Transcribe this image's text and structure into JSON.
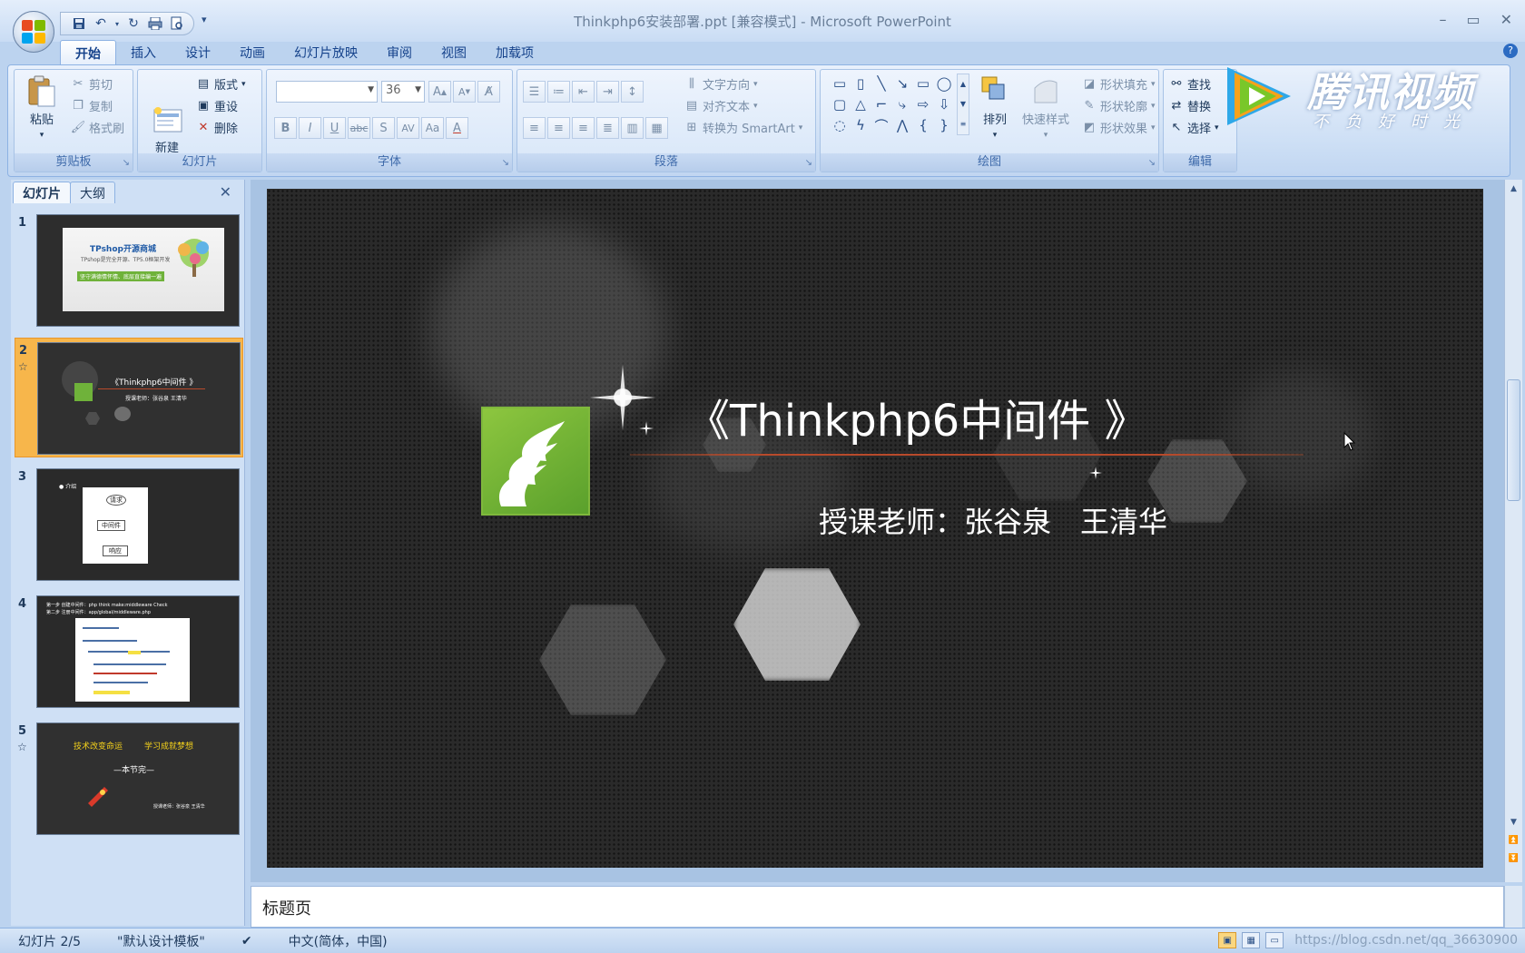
{
  "window": {
    "title": "Thinkphp6安装部署.ppt [兼容模式] - Microsoft PowerPoint",
    "controls": [
      "–",
      "▭",
      "✕"
    ]
  },
  "ribbon_tabs": [
    "开始",
    "插入",
    "设计",
    "动画",
    "幻灯片放映",
    "审阅",
    "视图",
    "加载项"
  ],
  "ribbon": {
    "clipboard": {
      "label": "剪贴板",
      "paste": "粘贴",
      "cut": "剪切",
      "copy": "复制",
      "format_painter": "格式刷"
    },
    "slides": {
      "label": "幻灯片",
      "new_slide": "新建\n幻灯片",
      "layout": "版式",
      "reset": "重设",
      "delete": "删除"
    },
    "font": {
      "label": "字体",
      "font_name": "",
      "font_size": "36"
    },
    "paragraph": {
      "label": "段落",
      "text_direction": "文字方向",
      "align_text": "对齐文本",
      "convert_smartart": "转换为 SmartArt"
    },
    "drawing": {
      "label": "绘图",
      "arrange": "排列",
      "quick_styles": "快速样式",
      "shape_fill": "形状填充",
      "shape_outline": "形状轮廓",
      "shape_effects": "形状效果"
    },
    "editing": {
      "label": "编辑",
      "find": "查找",
      "replace": "替换",
      "select": "选择"
    }
  },
  "tencent_watermark": {
    "name": "腾讯视频",
    "slogan": "不负好时光"
  },
  "panel": {
    "tabs": [
      "幻灯片",
      "大纲"
    ],
    "close": "✕",
    "thumbnails": [
      {
        "num": "1",
        "star": false,
        "line1": "TPshop开源商城",
        "line2": "TPshop是完全开源、TP5.0框架开发",
        "line3": "坚守满德情怀情、底层直接编一遍"
      },
      {
        "num": "2",
        "star": true,
        "line1": "《Thinkphp6中间件 》",
        "line2": "授课老师：张谷泉 王清华"
      },
      {
        "num": "3",
        "star": false,
        "line1": "请求",
        "line2": "中间件",
        "line3": "响应",
        "corner": "● 介绍"
      },
      {
        "num": "4",
        "star": false,
        "line1": "第一步 创建中间件：php think make:middleware Check",
        "line2": "第二步 注册中间件：app/global/middleware.php"
      },
      {
        "num": "5",
        "star": true,
        "line1": "技术改变命运",
        "line2": "学习成就梦想",
        "line3": "—本节完—",
        "line4": "授课老师：张谷泉 王清华"
      }
    ]
  },
  "slide": {
    "title": "《Thinkphp6中间件 》",
    "subtitle": "授课老师：张谷泉　王清华"
  },
  "notes": {
    "text": "标题页"
  },
  "statusbar": {
    "slide_indicator": "幻灯片 2/5",
    "theme": "\"默认设计模板\"",
    "language": "中文(简体，中国)",
    "url_watermark": "https://blog.csdn.net/qq_36630900"
  },
  "colors": {
    "accent": "#15428b",
    "slide_bg": "#2a2a2a",
    "logo_green": "#6fb23a",
    "title_line": "#b84a2b",
    "selected_thumb": "#f7b64b"
  }
}
